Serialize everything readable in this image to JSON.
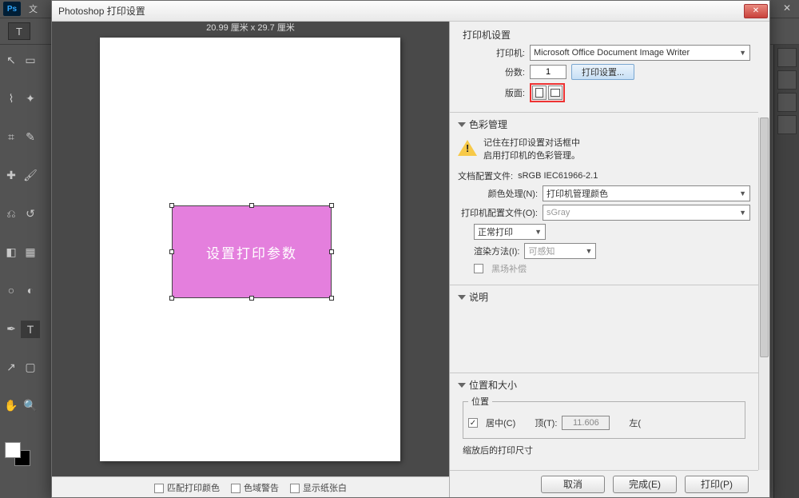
{
  "app": {
    "menubar_file": "文"
  },
  "dialog": {
    "title": "Photoshop 打印设置",
    "preview_dims": "20.99 厘米 x 29.7 厘米",
    "canvas_text": "设置打印参数",
    "footer": {
      "match_colors": "匹配打印颜色",
      "gamut_warn": "色域警告",
      "show_white": "显示纸张白"
    }
  },
  "printer_section": {
    "title": "打印机设置",
    "printer_label": "打印机:",
    "printer_value": "Microsoft Office Document Image Writer",
    "copies_label": "份数:",
    "copies_value": "1",
    "print_settings_btn": "打印设置...",
    "layout_label": "版面:"
  },
  "color_section": {
    "title": "色彩管理",
    "warn_line1": "记住在打印设置对话框中",
    "warn_line2": "启用打印机的色彩管理。",
    "doc_profile_label": "文档配置文件:",
    "doc_profile_value": "sRGB IEC61966-2.1",
    "handling_label": "颜色处理(N):",
    "handling_value": "打印机管理颜色",
    "printer_profile_label": "打印机配置文件(O):",
    "printer_profile_value": "sGray",
    "print_mode": "正常打印",
    "rendering_label": "渲染方法(I):",
    "rendering_value": "可感知",
    "black_point": "黑场补偿"
  },
  "desc_section": {
    "title": "说明"
  },
  "position_section": {
    "title": "位置和大小",
    "position_legend": "位置",
    "center_label": "居中(C)",
    "top_label": "顶(T):",
    "top_value": "11.606",
    "left_label": "左(",
    "scaled_label": "缩放后的打印尺寸"
  },
  "buttons": {
    "cancel": "取消",
    "done": "完成(E)",
    "print": "打印(P)"
  }
}
